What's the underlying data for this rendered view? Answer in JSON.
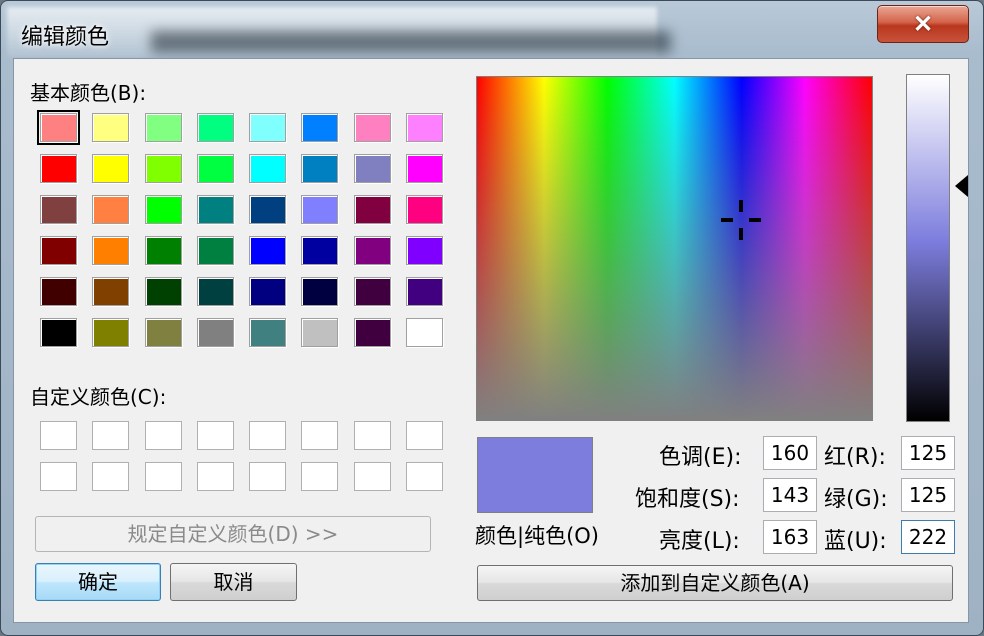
{
  "window": {
    "title": "编辑颜色",
    "close_label": "✕"
  },
  "basic": {
    "label": "基本颜色(B):",
    "colors": [
      [
        "#ff8080",
        "#ffff80",
        "#80ff80",
        "#00ff80",
        "#80ffff",
        "#0080ff",
        "#ff80c0",
        "#ff80ff"
      ],
      [
        "#ff0000",
        "#ffff00",
        "#80ff00",
        "#00ff40",
        "#00ffff",
        "#0080c0",
        "#8080c0",
        "#ff00ff"
      ],
      [
        "#804040",
        "#ff8040",
        "#00ff00",
        "#008080",
        "#004080",
        "#8080ff",
        "#800040",
        "#ff0080"
      ],
      [
        "#800000",
        "#ff8000",
        "#008000",
        "#008040",
        "#0000ff",
        "#0000a0",
        "#800080",
        "#8000ff"
      ],
      [
        "#400000",
        "#804000",
        "#004000",
        "#004040",
        "#000080",
        "#000040",
        "#400040",
        "#400080"
      ],
      [
        "#000000",
        "#808000",
        "#808040",
        "#808080",
        "#408080",
        "#c0c0c0",
        "#400040",
        "#ffffff"
      ]
    ]
  },
  "custom": {
    "label": "自定义颜色(C):"
  },
  "buttons": {
    "define_custom": "规定自定义颜色(D) >>",
    "ok": "确定",
    "cancel": "取消",
    "add_custom": "添加到自定义颜色(A)"
  },
  "preview": {
    "label": "颜色|纯色(O)",
    "color": "#7d7dde"
  },
  "fields": {
    "hue_label": "色调(E):",
    "hue": "160",
    "sat_label": "饱和度(S):",
    "sat": "143",
    "lum_label": "亮度(L):",
    "lum": "163",
    "red_label": "红(R):",
    "red": "125",
    "green_label": "绿(G):",
    "green": "125",
    "blue_label": "蓝(U):",
    "blue": "222"
  }
}
